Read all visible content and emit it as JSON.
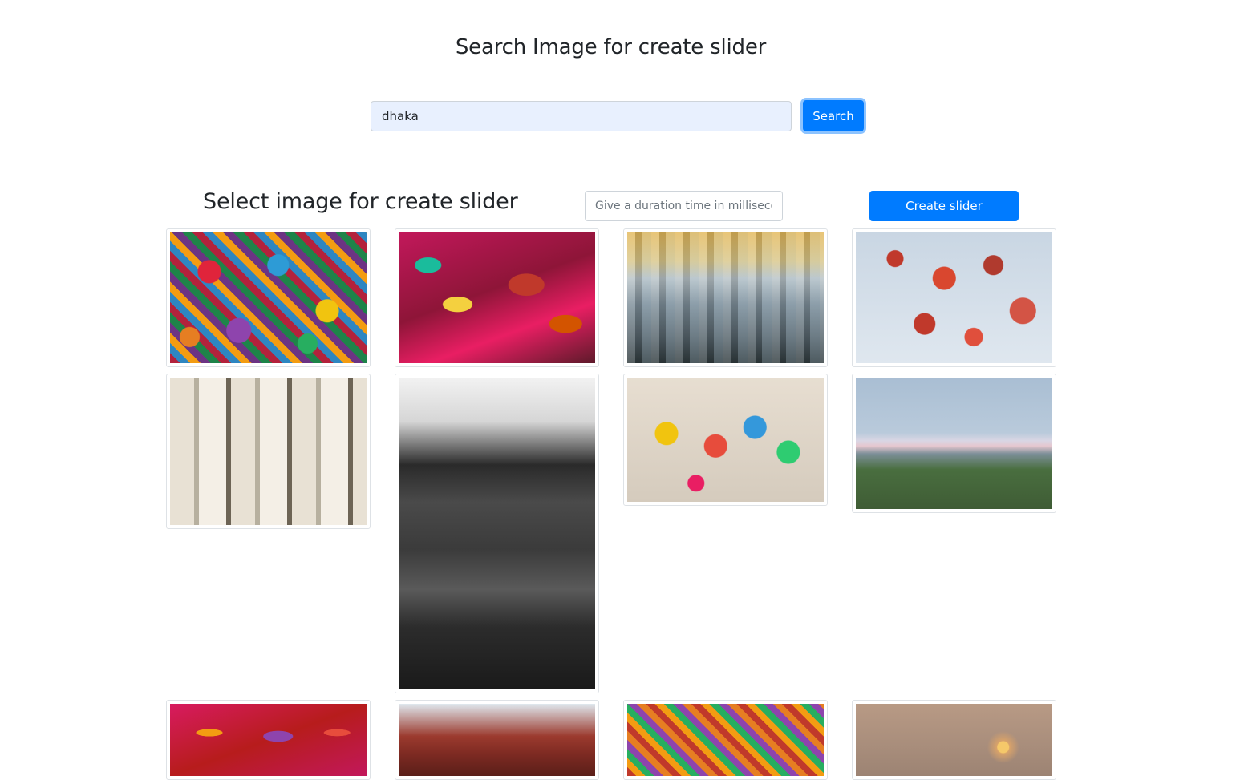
{
  "header": {
    "title": "Search Image for create slider"
  },
  "search": {
    "value": "dhaka",
    "button_label": "Search"
  },
  "slider": {
    "heading": "Select image for create slider",
    "duration_placeholder": "Give a duration time in milliseconds",
    "create_button_label": "Create slider"
  }
}
